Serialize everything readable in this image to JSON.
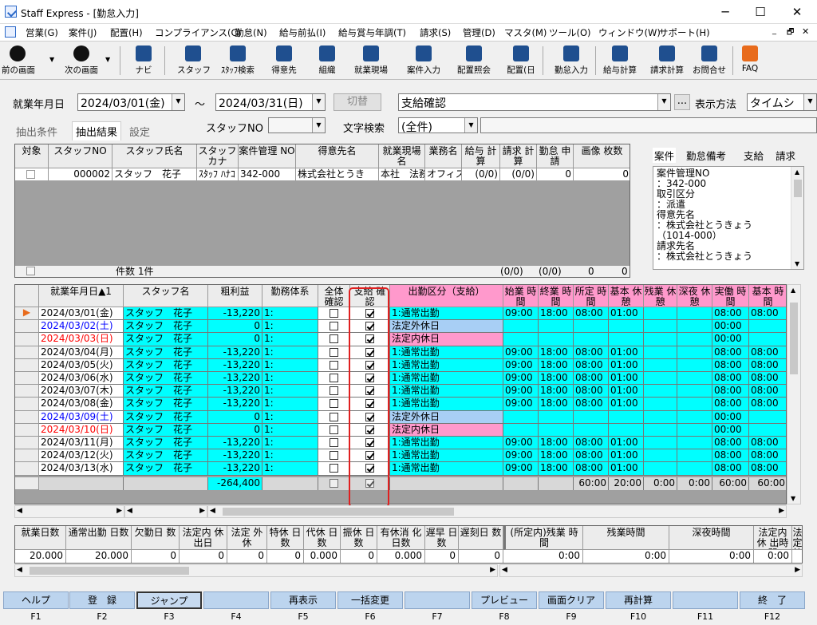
{
  "window": {
    "title": "Staff Express - [勤怠入力]"
  },
  "menu": [
    "営業(G)",
    "案件(J)",
    "配置(H)",
    "コンプライアンス(C)",
    "勤怠(N)",
    "給与前払(I)",
    "給与賞与年調(T)",
    "請求(S)",
    "管理(D)",
    "マスタ(M)",
    "ツール(O)",
    "ウィンドウ(W)",
    "サポート(H)"
  ],
  "toolbar": [
    "前の画面",
    "次の画面",
    "ナビ",
    "スタッフ",
    "ｽﾀｯﾌ検索",
    "得意先",
    "組織",
    "就業現場",
    "案件入力",
    "配置照会",
    "配置(日",
    "勤怠入力",
    "給与計算",
    "請求計算",
    "お問合せ",
    "FAQ"
  ],
  "filter": {
    "period_label": "就業年月日",
    "start": "2024/03/01(金)",
    "tilde": "〜",
    "end": "2024/03/31(日)",
    "switch": "切替",
    "mode": "支給確認",
    "ellipsis": "...",
    "display_label": "表示方法",
    "display_value": "タイムシ",
    "staff_no_label": "スタッフNO",
    "text_search_label": "文字検索",
    "text_search_value": "(全件)"
  },
  "tabs": [
    "抽出条件",
    "抽出結果",
    "設定"
  ],
  "top_grid": {
    "headers": [
      "対象",
      "スタッフNO",
      "スタッフ氏名",
      "スタッフ カナ",
      "案件管理 NO",
      "得意先名",
      "就業現場 名",
      "業務名",
      "給与 計算",
      "請求 計算",
      "勤怠 申請",
      "画像 枚数"
    ],
    "row": [
      "",
      "000002",
      "スタッフ　花子",
      "ｽﾀｯﾌ ﾊﾅｺ",
      "342-000",
      "株式会社とうき",
      "本社　法務",
      "オフィス",
      "(0/0)",
      "(0/0)",
      "0",
      "0"
    ],
    "footer": {
      "count": "件数 1件",
      "salary": "(0/0)",
      "billing": "(0/0)",
      "req": "0",
      "img": "0"
    }
  },
  "side_tabs": [
    "案件",
    "勤怠備考",
    "支給",
    "請求"
  ],
  "side_lines": [
    "案件管理NO",
    "：342-000",
    "取引区分",
    "：派遣",
    "得意先名",
    "：株式会社とうきょう",
    "（1014-000）",
    "請求先名",
    "：株式会社とうきょう"
  ],
  "main_grid": {
    "headers": [
      "就業年月日▲1",
      "スタッフ名",
      "粗利益",
      "勤務体系",
      "全体 確認",
      "支給 確認",
      "出勤区分（支給）",
      "始業 時間",
      "終業 時間",
      "所定 時間",
      "基本 休憩",
      "残業 休憩",
      "深夜 休憩",
      "実働 時間",
      "基本 時間"
    ],
    "rows": [
      [
        "2024/03/01(金)",
        "スタッフ　花子",
        "-13,220",
        "1:",
        "0",
        "1",
        "1:通常出勤",
        "09:00",
        "18:00",
        "08:00",
        "01:00",
        "",
        "",
        "08:00",
        "08:00"
      ],
      [
        "2024/03/02(土)",
        "スタッフ　花子",
        "0",
        "1:",
        "0",
        "1",
        "法定外休日",
        "",
        "",
        "",
        "",
        "",
        "",
        "00:00",
        ""
      ],
      [
        "2024/03/03(日)",
        "スタッフ　花子",
        "0",
        "1:",
        "0",
        "1",
        "法定内休日",
        "",
        "",
        "",
        "",
        "",
        "",
        "00:00",
        ""
      ],
      [
        "2024/03/04(月)",
        "スタッフ　花子",
        "-13,220",
        "1:",
        "0",
        "1",
        "1:通常出勤",
        "09:00",
        "18:00",
        "08:00",
        "01:00",
        "",
        "",
        "08:00",
        "08:00"
      ],
      [
        "2024/03/05(火)",
        "スタッフ　花子",
        "-13,220",
        "1:",
        "0",
        "1",
        "1:通常出勤",
        "09:00",
        "18:00",
        "08:00",
        "01:00",
        "",
        "",
        "08:00",
        "08:00"
      ],
      [
        "2024/03/06(水)",
        "スタッフ　花子",
        "-13,220",
        "1:",
        "0",
        "1",
        "1:通常出勤",
        "09:00",
        "18:00",
        "08:00",
        "01:00",
        "",
        "",
        "08:00",
        "08:00"
      ],
      [
        "2024/03/07(木)",
        "スタッフ　花子",
        "-13,220",
        "1:",
        "0",
        "1",
        "1:通常出勤",
        "09:00",
        "18:00",
        "08:00",
        "01:00",
        "",
        "",
        "08:00",
        "08:00"
      ],
      [
        "2024/03/08(金)",
        "スタッフ　花子",
        "-13,220",
        "1:",
        "0",
        "1",
        "1:通常出勤",
        "09:00",
        "18:00",
        "08:00",
        "01:00",
        "",
        "",
        "08:00",
        "08:00"
      ],
      [
        "2024/03/09(土)",
        "スタッフ　花子",
        "0",
        "1:",
        "0",
        "1",
        "法定外休日",
        "",
        "",
        "",
        "",
        "",
        "",
        "00:00",
        ""
      ],
      [
        "2024/03/10(日)",
        "スタッフ　花子",
        "0",
        "1:",
        "0",
        "1",
        "法定内休日",
        "",
        "",
        "",
        "",
        "",
        "",
        "00:00",
        ""
      ],
      [
        "2024/03/11(月)",
        "スタッフ　花子",
        "-13,220",
        "1:",
        "0",
        "1",
        "1:通常出勤",
        "09:00",
        "18:00",
        "08:00",
        "01:00",
        "",
        "",
        "08:00",
        "08:00"
      ],
      [
        "2024/03/12(火)",
        "スタッフ　花子",
        "-13,220",
        "1:",
        "0",
        "1",
        "1:通常出勤",
        "09:00",
        "18:00",
        "08:00",
        "01:00",
        "",
        "",
        "08:00",
        "08:00"
      ],
      [
        "2024/03/13(水)",
        "スタッフ　花子",
        "-13,220",
        "1:",
        "0",
        "1",
        "1:通常出勤",
        "09:00",
        "18:00",
        "08:00",
        "01:00",
        "",
        "",
        "08:00",
        "08:00"
      ]
    ],
    "totals": [
      "",
      "",
      "-264,400",
      "",
      "",
      "",
      "",
      "",
      "",
      "60:00",
      "20:00",
      "0:00",
      "0:00",
      "60:00",
      "60:00"
    ]
  },
  "summary": {
    "headers": [
      "就業日数",
      "通常出勤 日数",
      "欠勤日 数",
      "法定内 休出日",
      "法定 外休",
      "特休 日数",
      "代休 日数",
      "振休 日数",
      "有休消 化日数",
      "遅早 日数",
      "遅刻日 数",
      "(所定内)残業 時間",
      "残業時間",
      "深夜時間",
      "法定内休 出時間",
      "法定 外"
    ],
    "values": [
      "20.000",
      "20.000",
      "0",
      "0",
      "0",
      "0",
      "0.000",
      "0",
      "0.000",
      "0",
      "0",
      "0:00",
      "0:00",
      "0:00",
      "0:00",
      ""
    ]
  },
  "fkeys": [
    {
      "k": "F1",
      "l": "ヘルプ"
    },
    {
      "k": "F2",
      "l": "登　録"
    },
    {
      "k": "F3",
      "l": "ジャンプ"
    },
    {
      "k": "F4",
      "l": ""
    },
    {
      "k": "F5",
      "l": "再表示"
    },
    {
      "k": "F6",
      "l": "一括変更"
    },
    {
      "k": "F7",
      "l": ""
    },
    {
      "k": "F8",
      "l": "プレビュー"
    },
    {
      "k": "F9",
      "l": "画面クリア"
    },
    {
      "k": "F10",
      "l": "再計算"
    },
    {
      "k": "F11",
      "l": ""
    },
    {
      "k": "F12",
      "l": "終　了"
    }
  ],
  "colors": {
    "cyan": "#00ffff",
    "holiday_out": "#a8cff5",
    "holiday_in": "#ff99cc",
    "highlight": "#e02020",
    "sat": "#0000ff",
    "sun": "#ff0000"
  }
}
